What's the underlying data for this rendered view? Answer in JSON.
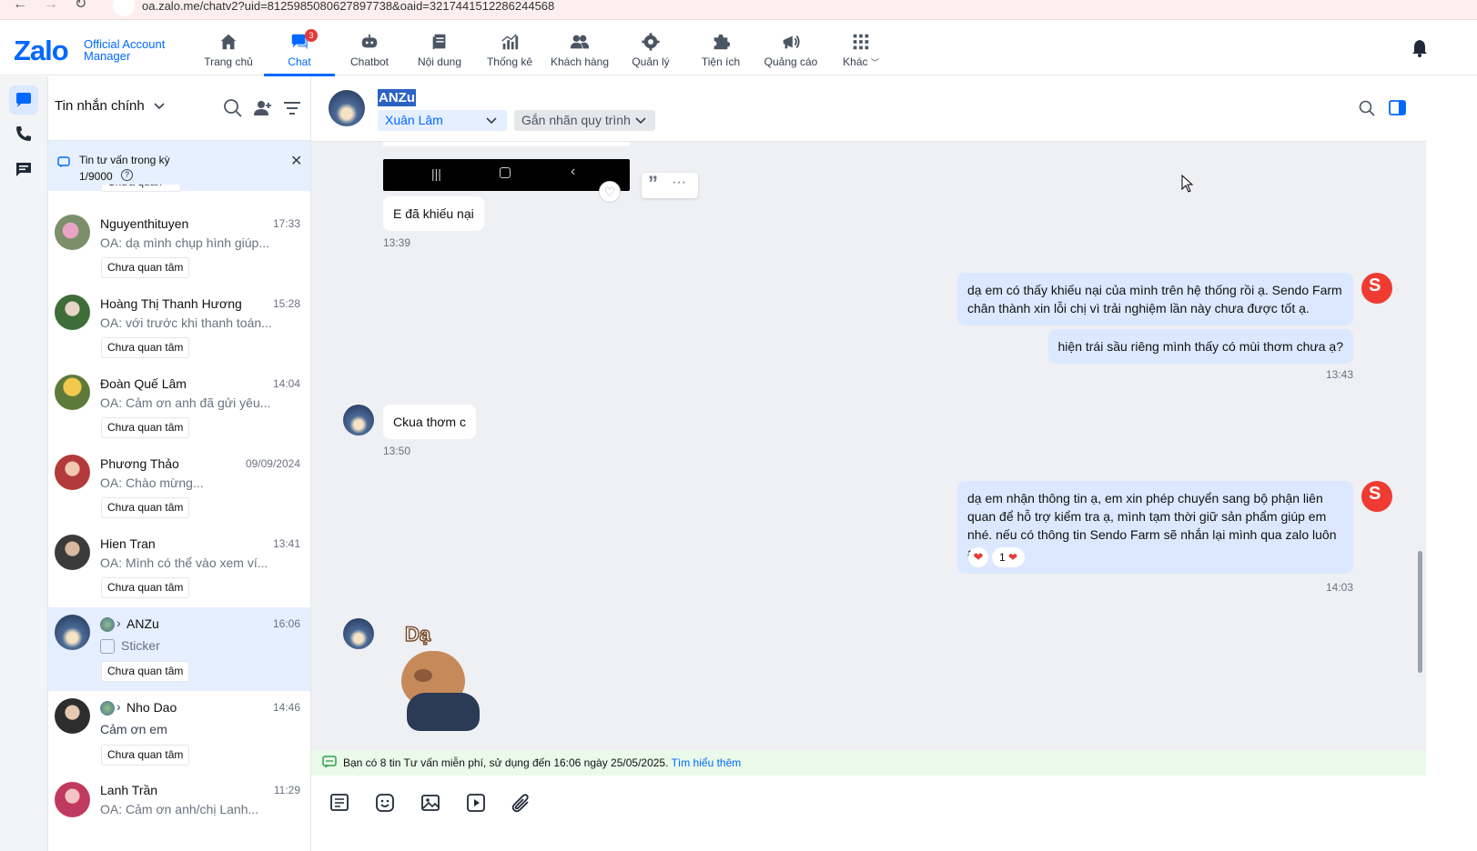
{
  "browser": {
    "url": "oa.zalo.me/chatv2?uid=8125985080627897738&oaid=3217441512286244568"
  },
  "logo": {
    "brand": "Zalo",
    "line1": "Official Account",
    "line2": "Manager"
  },
  "topnav": {
    "items": [
      {
        "label": "Trang chủ",
        "icon": "home-icon"
      },
      {
        "label": "Chat",
        "icon": "chat-icon",
        "badge": "3",
        "active": true
      },
      {
        "label": "Chatbot",
        "icon": "robot-icon"
      },
      {
        "label": "Nội dung",
        "icon": "content-icon"
      },
      {
        "label": "Thống kê",
        "icon": "stats-icon"
      },
      {
        "label": "Khách hàng",
        "icon": "customers-icon"
      },
      {
        "label": "Quản lý",
        "icon": "gear-icon"
      },
      {
        "label": "Tiện ích",
        "icon": "puzzle-icon"
      },
      {
        "label": "Quảng cáo",
        "icon": "ads-icon"
      },
      {
        "label": "Khác",
        "icon": "grid-icon"
      }
    ]
  },
  "list": {
    "title": "Tin nhắn chính",
    "quota_title": "Tin tư vấn trong kỳ",
    "quota_value": "1/9000",
    "partial_tag": "Chưa quan tâm",
    "conversations": [
      {
        "name": "Nguyenthituyen",
        "time": "17:33",
        "preview": "OA: dạ mình chụp hình giúp...",
        "tag": "Chưa quan tâm"
      },
      {
        "name": "Hoàng Thị Thanh Hương",
        "time": "15:28",
        "preview": "OA: với trước khi thanh toán...",
        "tag": "Chưa quan tâm"
      },
      {
        "name": "Đoàn Quế Lâm",
        "time": "14:04",
        "preview": "OA: Cảm ơn anh đã gửi yêu...",
        "tag": "Chưa quan tâm"
      },
      {
        "name": "Phương Thảo",
        "time": "09/09/2024",
        "preview": "OA: Chào mừng...",
        "tag": "Chưa quan tâm"
      },
      {
        "name": "Hien Tran",
        "time": "13:41",
        "preview": "OA: Mình có thể vào xem ví...",
        "tag": "Chưa quan tâm"
      },
      {
        "name": "ANZu",
        "time": "16:06",
        "preview": "Sticker",
        "tag": "Chưa quan tâm",
        "active": true
      },
      {
        "name": "Nho Dao",
        "time": "14:46",
        "preview": "Cảm ơn em",
        "tag": "Chưa quan tâm"
      },
      {
        "name": "Lanh Trần",
        "time": "11:29",
        "preview": "OA: Cảm ơn anh/chị Lanh..."
      }
    ]
  },
  "chat": {
    "contact_name": "ANZu",
    "assignee": "Xuân Lâm",
    "label_select": "Gắn nhãn quy trình",
    "messages": {
      "m1_text": "E đã khiếu nại",
      "m1_time": "13:39",
      "m2_text": "dạ em có thấy khiếu nại của mình trên hệ thống rồi ạ. Sendo Farm chân thành xin lỗi chị vì trải nghiệm lần này chưa được tốt ạ.",
      "m3_text": "hiện trái sầu riêng mình thấy có mùi thơm chưa ạ?",
      "m3_time": "13:43",
      "m4_text": "Ckua thơm c",
      "m4_time": "13:50",
      "m5_text": "dạ em nhận thông tin ạ, em xin phép chuyển sang bộ phận liên quan để hỗ trợ kiểm tra ạ, mình tạm thời giữ sản phẩm giúp em nhé. nếu có thông tin Sendo Farm sẽ nhắn lại mình qua zalo luôn ạ.",
      "m5_reaction_count": "1",
      "m5_time": "14:03",
      "sticker_text": "Dạ"
    },
    "notice_text": "Bạn có 8 tin Tư vấn miễn phí, sử dụng đến 16:06 ngày 25/05/2025.",
    "notice_link": "Tìm hiểu thêm"
  },
  "colors": {
    "accent": "#0068ff",
    "oa_brand": "#ef3b32"
  }
}
